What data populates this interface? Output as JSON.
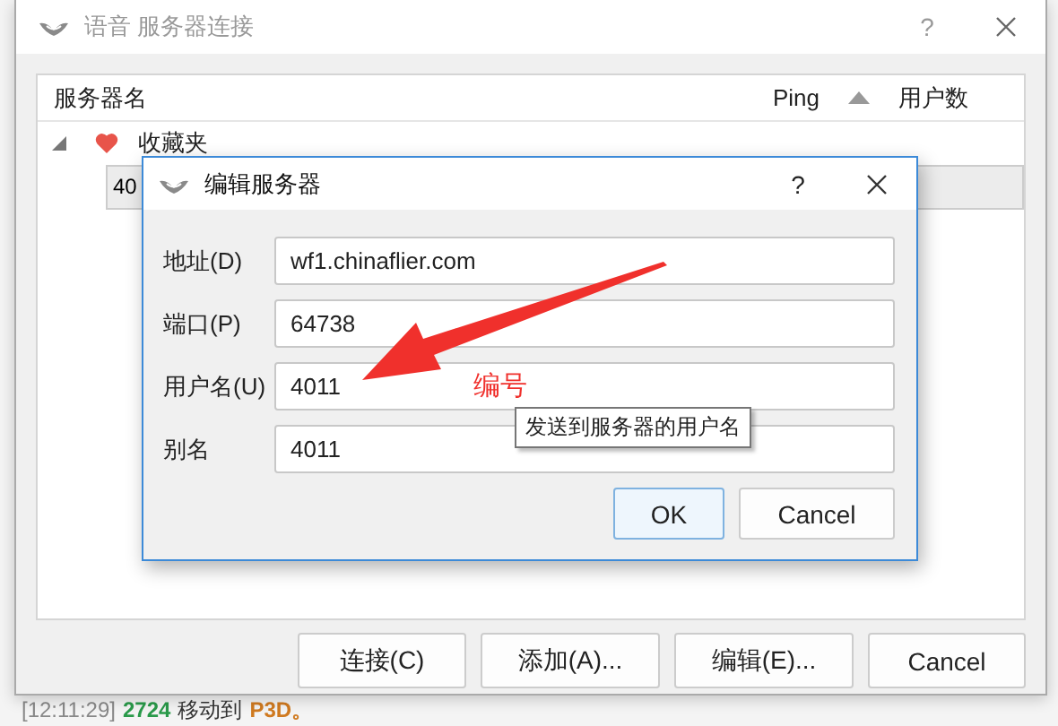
{
  "window": {
    "title": "语音 服务器连接",
    "help": "?"
  },
  "tree": {
    "columns": [
      {
        "label": "服务器名",
        "sorted": false
      },
      {
        "label": "Ping",
        "sorted": true
      },
      {
        "label": "用户数",
        "sorted": false
      }
    ],
    "items": [
      {
        "label": "收藏夹",
        "kind": "favorites",
        "expanded": true,
        "children": [
          {
            "label": "40",
            "selected": true
          }
        ]
      }
    ]
  },
  "buttons": [
    {
      "label": "连接(C)"
    },
    {
      "label": "添加(A)..."
    },
    {
      "label": "编辑(E)..."
    },
    {
      "label": "Cancel"
    }
  ],
  "dialog": {
    "title": "编辑服务器",
    "help": "?",
    "fields": [
      {
        "label": "地址(D)",
        "value": "wf1.chinaflier.com"
      },
      {
        "label": "端口(P)",
        "value": "64738"
      },
      {
        "label": "用户名(U)",
        "value": "4011"
      },
      {
        "label": "别名",
        "value": "4011"
      }
    ],
    "buttons": [
      {
        "label": "OK",
        "default": true
      },
      {
        "label": "Cancel",
        "default": false
      }
    ]
  },
  "tooltip": {
    "text": "发送到服务器的用户名"
  },
  "annotation": {
    "text": "编号"
  },
  "background_log": {
    "time": "[12:11:29]",
    "user": "2724",
    "action": "移动到",
    "target": "P3D。"
  }
}
